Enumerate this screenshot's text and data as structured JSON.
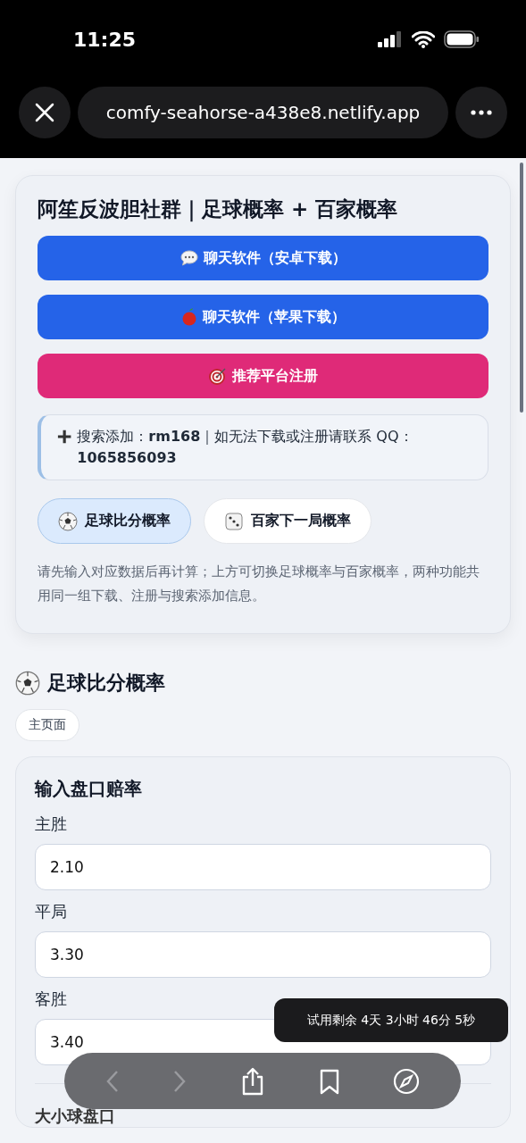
{
  "status_bar": {
    "time": "11:25"
  },
  "browser": {
    "url": "comfy-seahorse-a438e8.netlify.app"
  },
  "header_card": {
    "title": "阿笙反波胆社群｜足球概率 + 百家概率",
    "buttons": [
      {
        "label": "聊天软件（安卓下载）",
        "kind": "android"
      },
      {
        "label": "聊天软件（苹果下载）",
        "kind": "apple"
      },
      {
        "label": "推荐平台注册",
        "kind": "register"
      }
    ],
    "info": "搜索添加：**rm168**｜如无法下载或注册请联系 QQ：**1065856093**",
    "tabs": [
      {
        "label": "足球比分概率",
        "kind": "football",
        "selected": true
      },
      {
        "label": "百家下一局概率",
        "kind": "baccarat",
        "selected": false
      }
    ],
    "note": "请先输入对应数据后再计算；上方可切换足球概率与百家概率，两种功能共用同一组下载、注册与搜索添加信息。"
  },
  "section": {
    "title": "足球比分概率",
    "chip": "主页面"
  },
  "odds_card": {
    "title": "输入盘口赔率",
    "fields": [
      {
        "label": "主胜",
        "value": "2.10"
      },
      {
        "label": "平局",
        "value": "3.30"
      },
      {
        "label": "客胜",
        "value": "3.40"
      }
    ],
    "next_heading": "大小球盘口"
  },
  "toast": "试用剩余 4天 3小时 46分 5秒",
  "toolbar": {
    "back_disabled": true,
    "forward_disabled": true
  }
}
